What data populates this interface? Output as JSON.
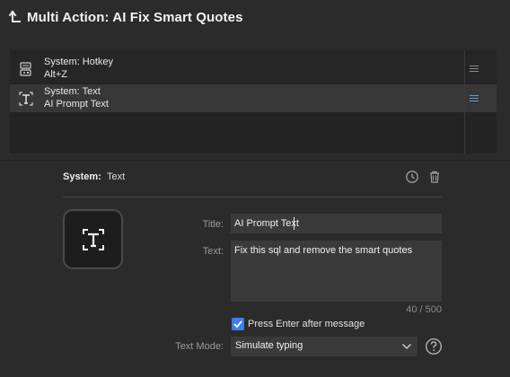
{
  "header": {
    "title": "Multi Action: AI Fix Smart Quotes",
    "back_icon": "return-arrow-icon"
  },
  "actions": [
    {
      "icon": "hotkey-icon",
      "line1": "System: Hotkey",
      "line2": "Alt+Z",
      "selected": false
    },
    {
      "icon": "text-icon",
      "line1": "System: Text",
      "line2": "AI Prompt Text",
      "selected": true
    }
  ],
  "panel": {
    "category_label": "System:",
    "category_value": "Text",
    "title_label": "Title:",
    "title_value": "AI Prompt Text",
    "text_label": "Text:",
    "text_value": "Fix this sql and remove the smart quotes",
    "counter": "40 / 500",
    "checkbox_label": "Press Enter after message",
    "checkbox_checked": true,
    "mode_label": "Text Mode:",
    "mode_value": "Simulate typing"
  },
  "colors": {
    "background": "#2b2b2b",
    "selected_row": "#373737",
    "accent": "#3d7ef0",
    "input_bg": "#3a3a3a"
  }
}
